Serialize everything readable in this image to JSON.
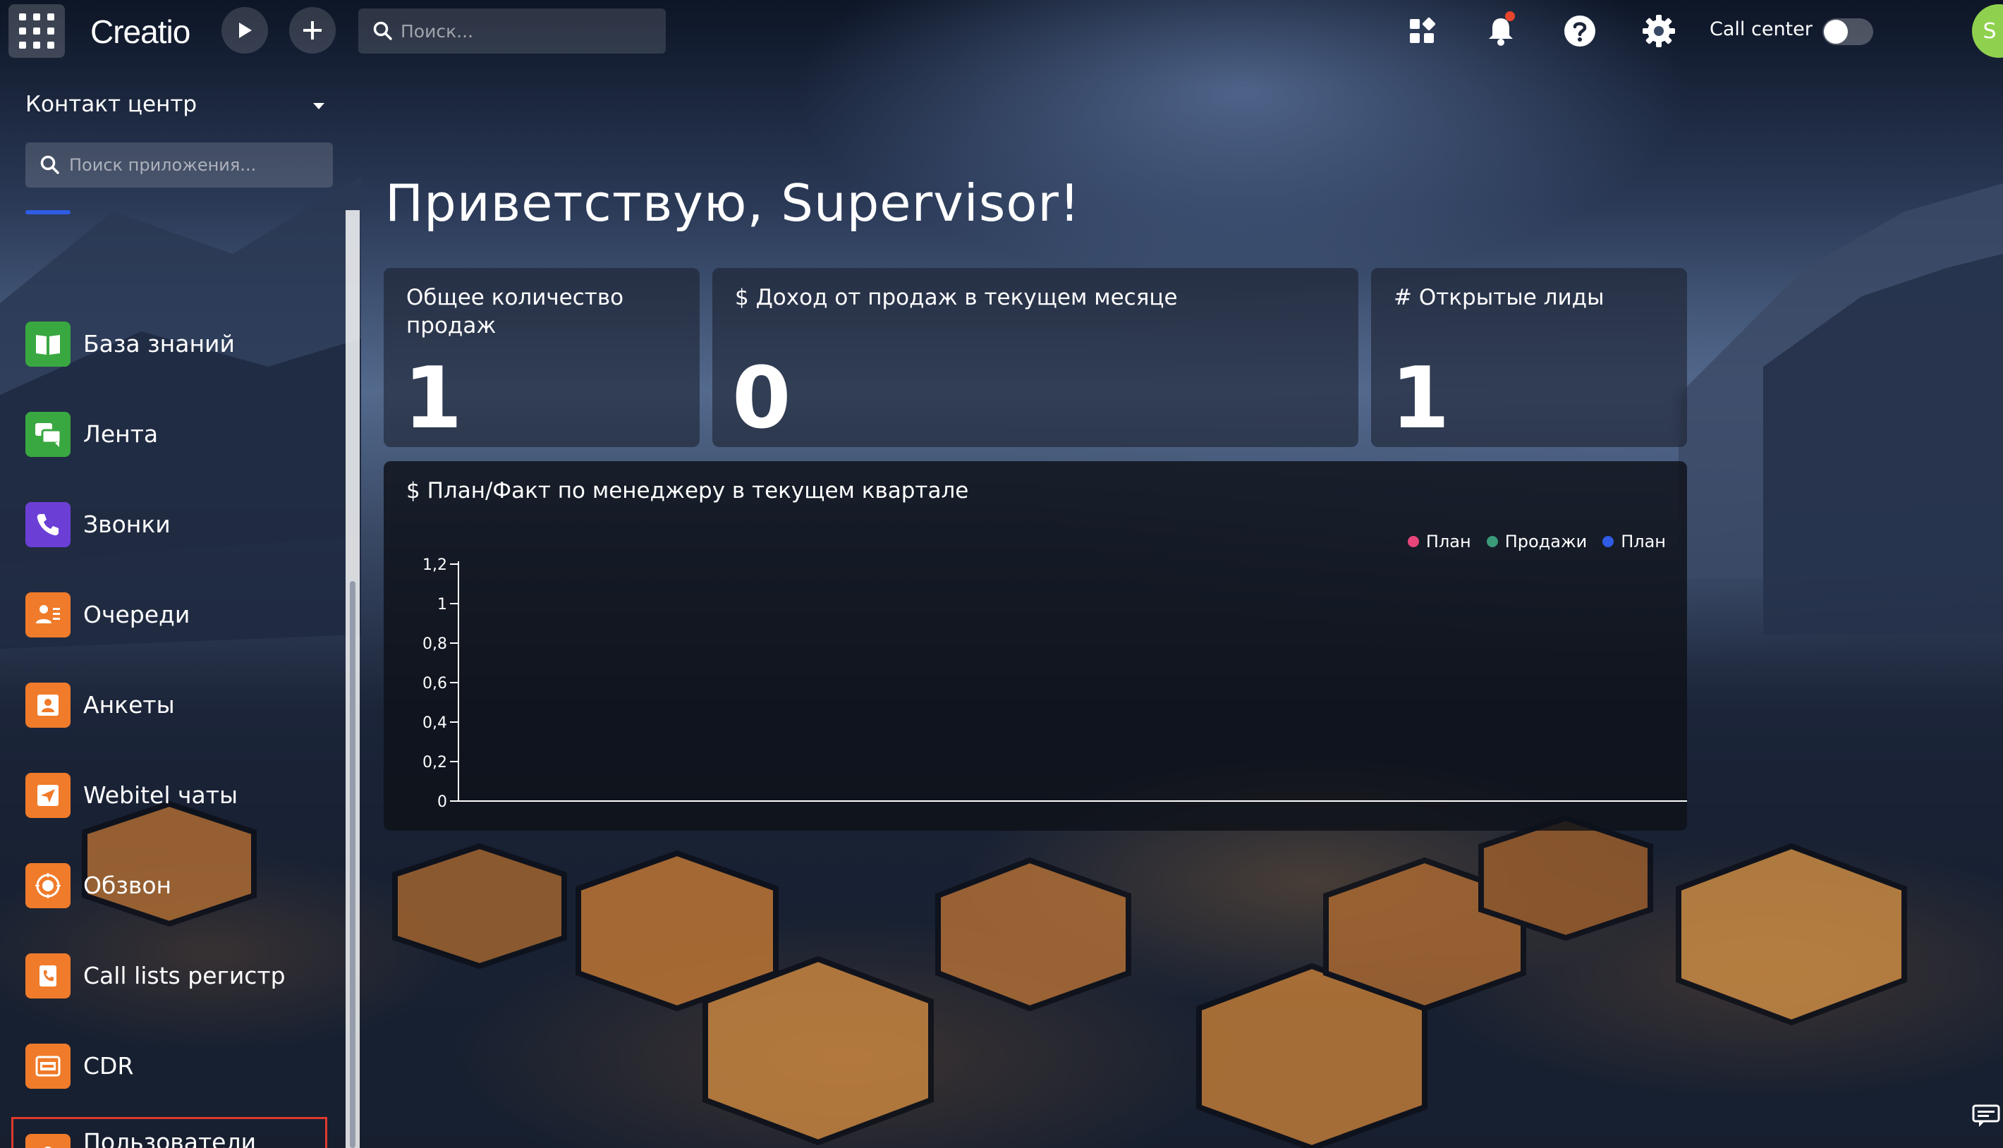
{
  "app": {
    "logo": "Creatio",
    "search_placeholder": "Поиск...",
    "call_center_label": "Call center",
    "call_center_on": false,
    "user_initial": "S",
    "notification_dot_color": "#e8452c"
  },
  "sidebar": {
    "workspace": "Контакт центр",
    "search_placeholder": "Поиск приложения...",
    "items": [
      {
        "label": "База знаний",
        "icon": "book-icon",
        "color": "#3aa841"
      },
      {
        "label": "Лента",
        "icon": "chat-bubbles-icon",
        "color": "#3aa841"
      },
      {
        "label": "Звонки",
        "icon": "phone-icon",
        "color": "#6b3fd6"
      },
      {
        "label": "Очереди",
        "icon": "queue-people-icon",
        "color": "#f07b2a"
      },
      {
        "label": "Анкеты",
        "icon": "profile-card-icon",
        "color": "#f07b2a"
      },
      {
        "label": "Webitel чаты",
        "icon": "send-icon",
        "color": "#f07b2a"
      },
      {
        "label": "Обзвон",
        "icon": "dialer-icon",
        "color": "#f07b2a"
      },
      {
        "label": "Call lists регистр",
        "icon": "call-list-icon",
        "color": "#f07b2a"
      },
      {
        "label": "CDR",
        "icon": "cdr-icon",
        "color": "#f07b2a"
      },
      {
        "label": "Пользователи Webitel",
        "icon": "users-icon",
        "color": "#f07b2a",
        "active": true
      }
    ]
  },
  "main": {
    "greeting": "Приветствую, Supervisor!",
    "cards": [
      {
        "title": "Общее количество продаж",
        "value": "1"
      },
      {
        "title": "$ Доход от продаж в текущем месяце",
        "value": "0"
      },
      {
        "title": "# Открытые лиды",
        "value": "1"
      }
    ]
  },
  "chart_data": {
    "type": "bar",
    "title": "$ План/Факт по менеджеру в текущем квартале",
    "categories": [],
    "series": [
      {
        "name": "План",
        "color": "#e8457a",
        "values": []
      },
      {
        "name": "Продажи",
        "color": "#3b9a7a",
        "values": []
      },
      {
        "name": "План",
        "color": "#2f5ce4",
        "values": []
      }
    ],
    "yticks": [
      "0",
      "0,2",
      "0,4",
      "0,6",
      "0,8",
      "1",
      "1,2"
    ],
    "ylim": [
      0,
      1.2
    ],
    "legend": "top-right"
  }
}
